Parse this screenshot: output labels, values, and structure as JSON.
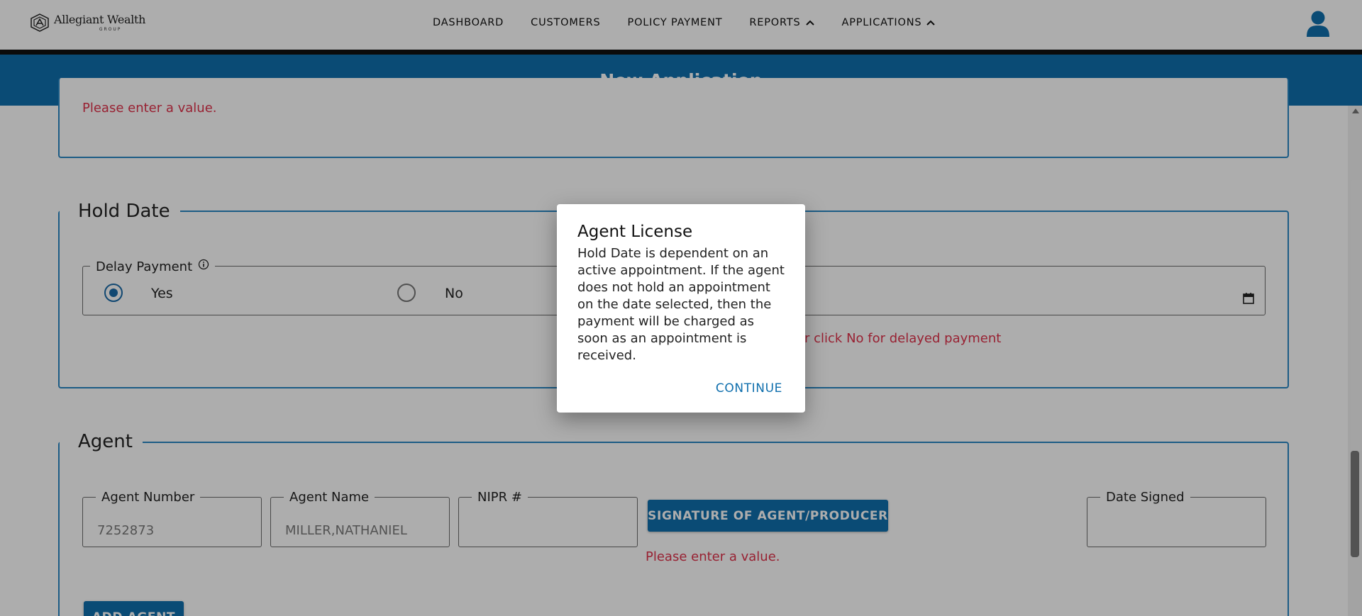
{
  "nav": {
    "logo_name": "Allegiant Wealth",
    "logo_sub": "GROUP",
    "items": [
      "DASHBOARD",
      "CUSTOMERS",
      "POLICY PAYMENT",
      "REPORTS",
      "APPLICATIONS"
    ]
  },
  "titlebar": {
    "title": "New Application"
  },
  "top_section": {
    "error": "Please enter a value."
  },
  "hold_date": {
    "legend": "Hold Date",
    "delay_payment_label": "Delay Payment",
    "option_yes": "Yes",
    "option_no": "No",
    "selected": "Yes",
    "error": "r click No for delayed payment"
  },
  "agent": {
    "legend": "Agent",
    "agent_number_label": "Agent Number",
    "agent_number_value": "7252873",
    "agent_name_label": "Agent Name",
    "agent_name_value": "MILLER,NATHANIEL",
    "nipr_label": "NIPR #",
    "nipr_value": "",
    "signature_button": "SIGNATURE OF AGENT/PRODUCER",
    "signature_error": "Please enter a value.",
    "date_signed_label": "Date Signed",
    "add_agent_button": "ADD AGENT"
  },
  "dialog": {
    "title": "Agent License",
    "body": "Hold Date is dependent on an active appointment. If the agent does not hold an appointment on the date selected, then the payment will be charged as soon as an appointment is received.",
    "continue_button": "CONTINUE"
  },
  "colors": {
    "brand_blue": "#0f6fad",
    "card_border": "#2a88c5",
    "error_red": "#e0314b"
  }
}
